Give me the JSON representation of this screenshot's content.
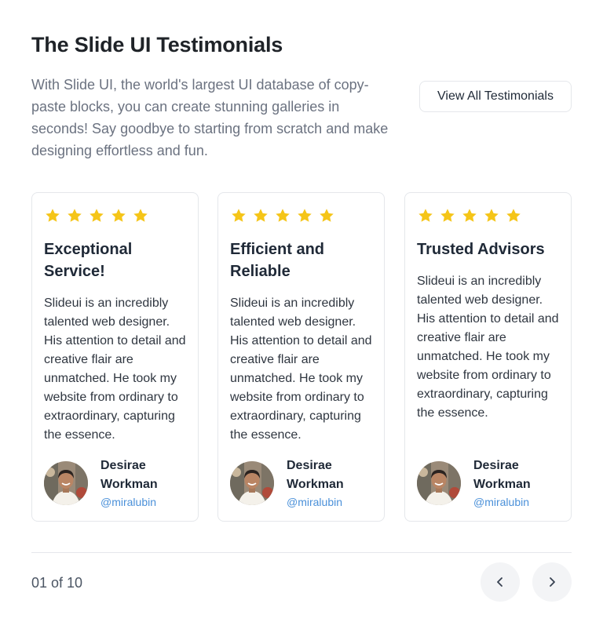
{
  "header": {
    "title": "The Slide UI Testimonials",
    "intro": "With Slide UI, the world's largest UI database of copy-paste blocks, you can create stunning galleries in seconds! Say goodbye to starting from scratch and make designing effortless and fun.",
    "view_all_label": "View All Testimonials"
  },
  "colors": {
    "star": "#F5C518",
    "handle": "#4A90D9",
    "nav_bg": "#F3F4F6"
  },
  "testimonials": [
    {
      "rating": 5,
      "title": "Exceptional Service!",
      "body": "Slideui is an incredibly talented web designer. His attention to detail and creative flair are unmatched. He took my website from ordinary to extraordinary, capturing the essence.",
      "author_name": "Desirae Workman",
      "author_handle": "@miralubin"
    },
    {
      "rating": 5,
      "title": "Efficient and Reliable",
      "body": "Slideui is an incredibly talented web designer. His attention to detail and creative flair are unmatched. He took my website from ordinary to extraordinary, capturing the essence.",
      "author_name": "Desirae Workman",
      "author_handle": "@miralubin"
    },
    {
      "rating": 5,
      "title": "Trusted Advisors",
      "body": "Slideui is an incredibly talented web designer. His attention to detail and creative flair are unmatched. He took my website from ordinary to extraordinary, capturing the essence.",
      "author_name": "Desirae Workman",
      "author_handle": "@miralubin"
    }
  ],
  "pagination": {
    "counter": "01 of 10",
    "prev_icon": "chevron-left-icon",
    "next_icon": "chevron-right-icon"
  }
}
